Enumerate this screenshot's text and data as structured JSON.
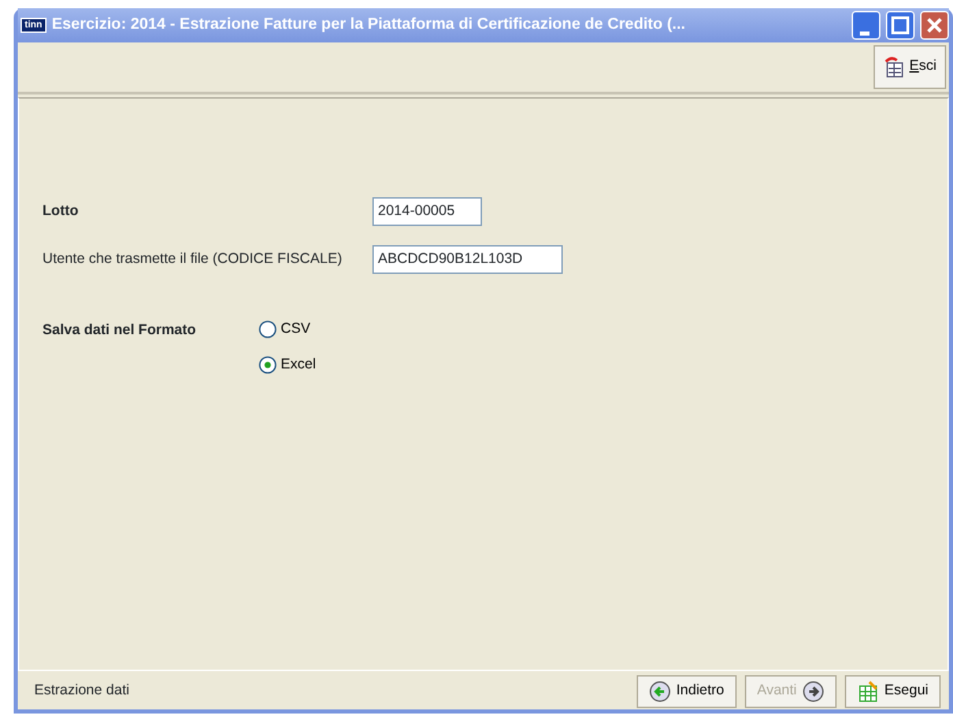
{
  "window": {
    "title": "Esercizio: 2014 - Estrazione Fatture per la Piattaforma di Certificazione de Credito (...",
    "app_badge": "tinn"
  },
  "toolbar": {
    "buttons": [
      {
        "label": "Esci"
      }
    ]
  },
  "form": {
    "fields": [
      {
        "label": "Lotto",
        "bold": true,
        "value": "2014-00005"
      },
      {
        "label": "Utente che trasmette il file (CODICE FISCALE)",
        "bold": false,
        "value": "ABCDCD90B12L103D"
      }
    ],
    "format": {
      "label": "Salva dati nel Formato",
      "options": [
        {
          "label": "CSV",
          "selected": false
        },
        {
          "label": "Excel",
          "selected": true
        }
      ]
    }
  },
  "status_bar": {
    "text": "Estrazione dati",
    "buttons": [
      {
        "label": "Indietro",
        "kind": "back",
        "disabled": false
      },
      {
        "label": "Avanti",
        "kind": "next",
        "disabled": true
      },
      {
        "label": "Esegui",
        "kind": "run",
        "disabled": false
      }
    ]
  }
}
